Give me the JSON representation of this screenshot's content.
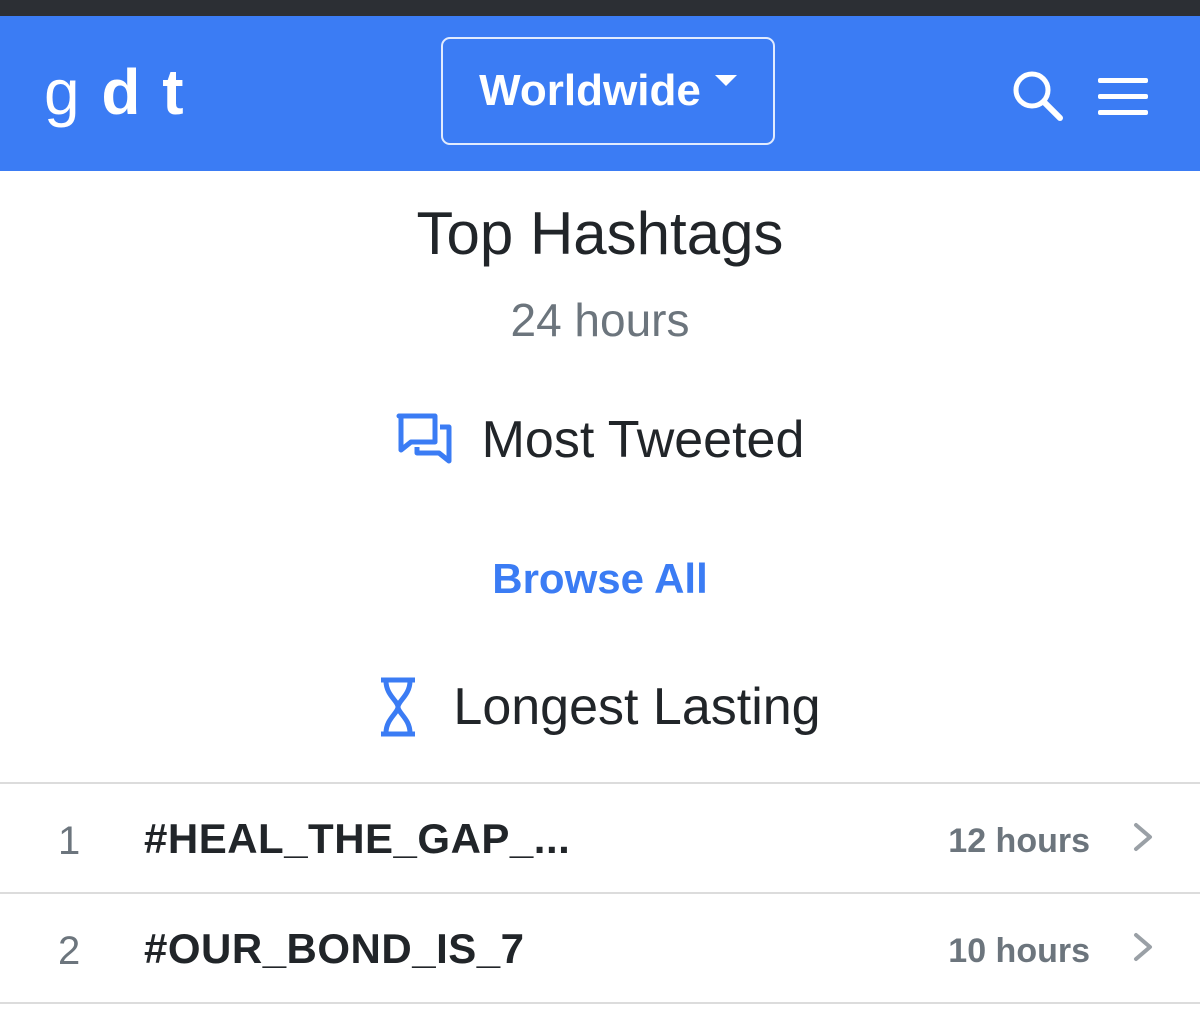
{
  "navbar": {
    "logo_light": "g",
    "logo_bold": "d t",
    "region_label": "Worldwide",
    "brand_color": "#3b7cf4",
    "search_icon": "search-icon",
    "menu_icon": "hamburger-menu-icon"
  },
  "main": {
    "title": "Top Hashtags",
    "subtitle": "24 hours",
    "most_tweeted": {
      "label": "Most Tweeted",
      "icon": "chat-bubbles-icon"
    },
    "browse_all": "Browse All",
    "longest_lasting": {
      "label": "Longest Lasting",
      "icon": "hourglass-icon"
    }
  },
  "hashtags": [
    {
      "rank": "1",
      "tag": "#HEAL_THE_GAP_...",
      "duration": "12 hours"
    },
    {
      "rank": "2",
      "tag": "#OUR_BOND_IS_7",
      "duration": "10 hours"
    }
  ],
  "colors": {
    "accent": "#3b7cf4",
    "muted_text": "#6c757d",
    "body_text": "#212529"
  }
}
